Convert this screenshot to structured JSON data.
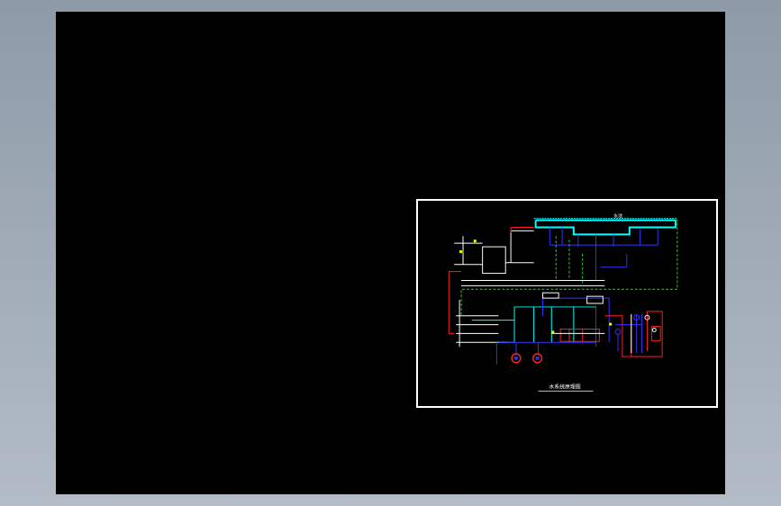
{
  "drawing": {
    "title_text": "水系统原理图",
    "pool_label": "水池",
    "colors": {
      "background": "#000000",
      "frame": "#ffffff",
      "cyan": "#00ffff",
      "blue": "#3333ff",
      "green": "#33cc33",
      "red": "#ff2020",
      "white": "#ffffff",
      "yellow": "#ffff00"
    }
  }
}
